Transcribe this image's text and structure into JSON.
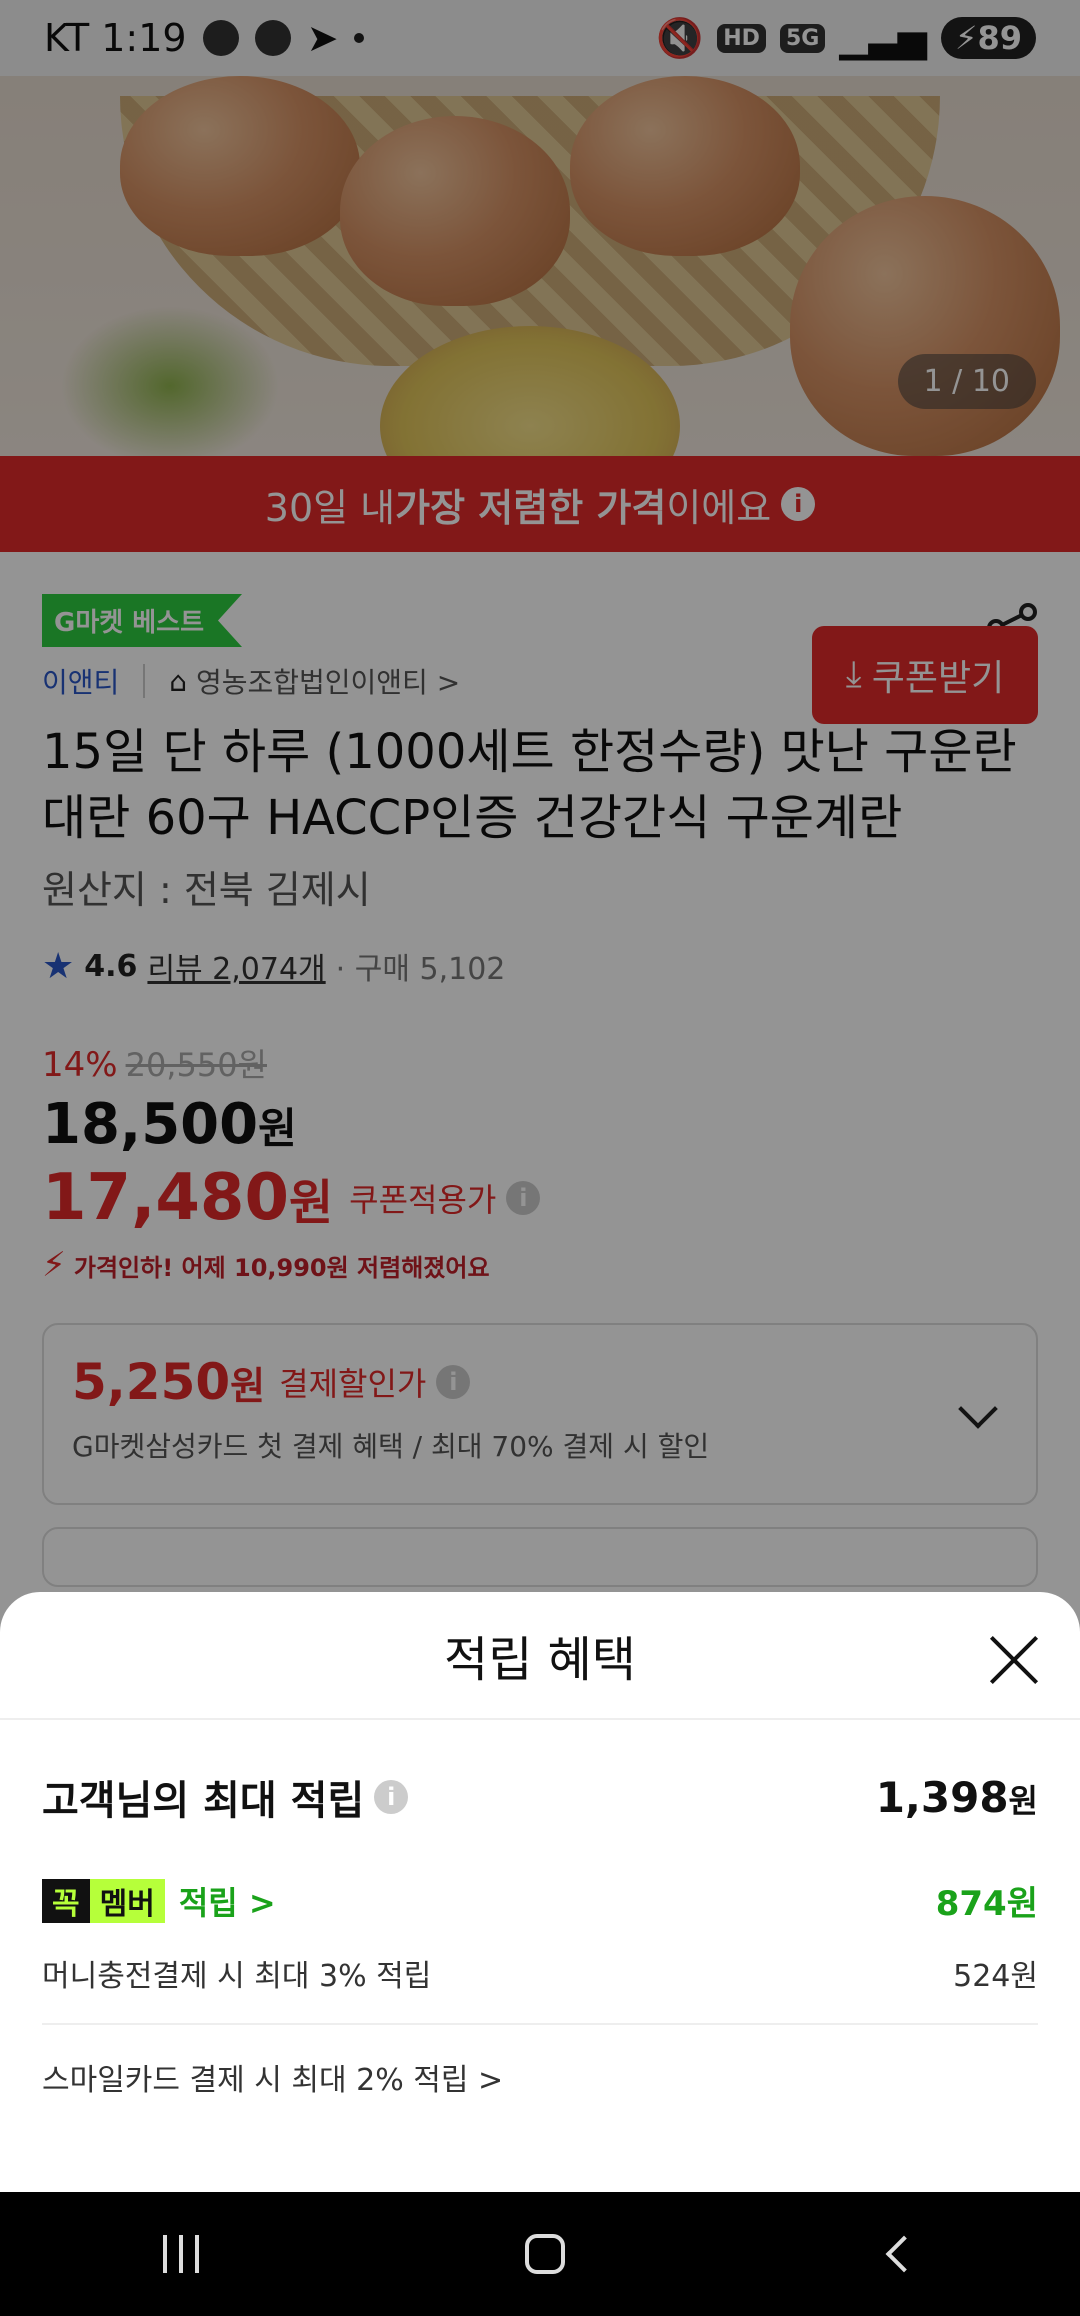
{
  "status_bar": {
    "carrier_time": "KT 1:19",
    "battery": "89",
    "hd": "HD",
    "net": "5G"
  },
  "hero": {
    "pager": "1 / 10"
  },
  "banner": {
    "prefix": "30일 내 ",
    "bold": "가장 저렴한 가격",
    "suffix": "이에요",
    "info": "i"
  },
  "product": {
    "badge": "G마켓 베스트",
    "seller": "이앤티",
    "store": "영농조합법인이앤티 >",
    "title": "15일 단 하루 (1000세트 한정수량) 맛난 구운란 대란 60구 HACCP인증 건강간식 구운계란",
    "origin": "원산지 : 전북 김제시",
    "rating": "4.6",
    "reviews": "리뷰 2,074개",
    "purchases": "· 구매 5,102",
    "discount": "14%",
    "original_price": "20,550원",
    "price_num": "18,500",
    "price_unit": "원",
    "coupon_price_num": "17,480",
    "coupon_price_unit": "원",
    "coupon_label": "쿠폰적용가",
    "coupon_button": "쿠폰받기",
    "price_drop": "가격인하! 어제 10,990원 저렴해졌어요",
    "pay_price_num": "5,250",
    "pay_price_unit": "원",
    "pay_label": "결제할인가",
    "pay_desc": "G마켓삼성카드 첫 결제 혜택 / 최대 70% 결제 시 할인"
  },
  "sheet": {
    "title": "적립 혜택",
    "max_label": "고객님의 최대 적립",
    "max_amount_num": "1,398",
    "max_amount_unit": "원",
    "member_badge_a": "꼭",
    "member_badge_b": "멤버",
    "member_link": "적립 >",
    "member_amount": "874원",
    "money_label": "머니충전결제 시 최대 3% 적립",
    "money_amount": "524원",
    "smile_label": "스마일카드 결제 시 최대 2% 적립 >"
  },
  "icons": {
    "share": "share-icon",
    "close": "close-icon",
    "info": "info-icon",
    "star": "star-icon",
    "download": "download-icon",
    "chevron": "chevron-down-icon"
  },
  "colors": {
    "accent_red": "#e02a2a",
    "member_green": "#1aa21a",
    "badge_green": "#2ecc40"
  }
}
